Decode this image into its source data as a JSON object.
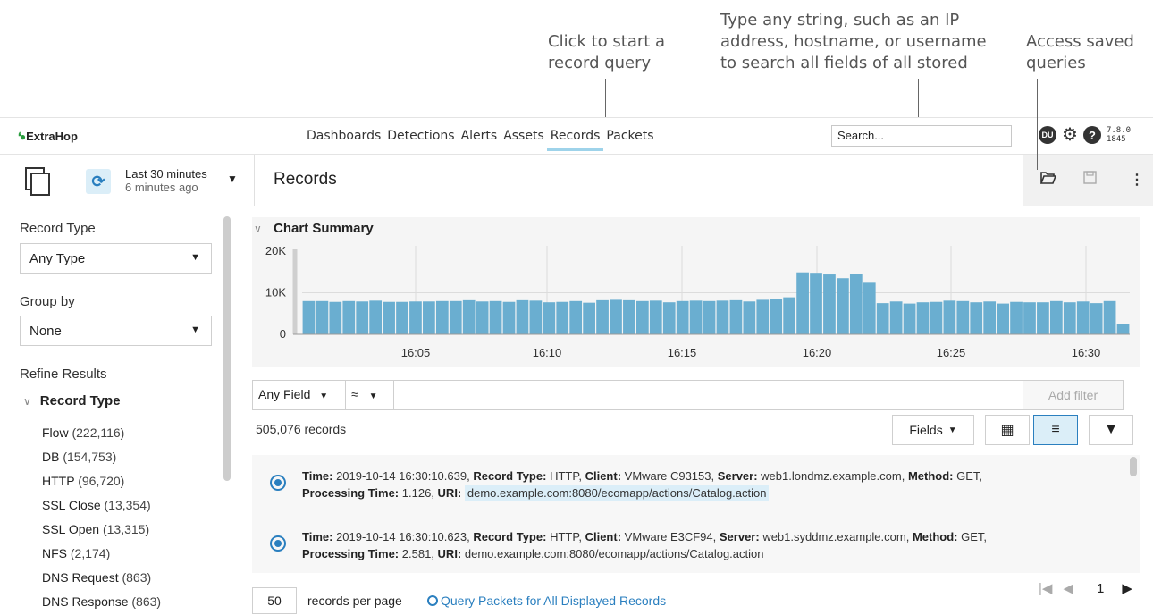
{
  "callouts": {
    "records": [
      "Click to start a",
      "record query"
    ],
    "search": [
      "Type any string, such as an IP",
      "address, hostname, or username",
      "to search all fields of all stored"
    ],
    "saved": [
      "Access saved",
      "queries"
    ]
  },
  "nav": {
    "logo": "ExtraHop",
    "links": [
      "Dashboards",
      "Detections",
      "Alerts",
      "Assets",
      "Records",
      "Packets"
    ],
    "active": "Records",
    "search_value": "Search...",
    "avatar": "DU",
    "version_line1": "7.8.0",
    "version_line2": "1845"
  },
  "toolbar": {
    "time_range": "Last 30 minutes",
    "time_sub": "6 minutes ago",
    "title": "Records"
  },
  "sidebar": {
    "record_type_label": "Record Type",
    "record_type_value": "Any Type",
    "group_by_label": "Group by",
    "group_by_value": "None",
    "refine_label": "Refine Results",
    "refine_group": "Record Type",
    "items": [
      {
        "name": "Flow",
        "count": "(222,116)"
      },
      {
        "name": "DB",
        "count": "(154,753)"
      },
      {
        "name": "HTTP",
        "count": "(96,720)"
      },
      {
        "name": "SSL Close",
        "count": "(13,354)"
      },
      {
        "name": "SSL Open",
        "count": "(13,315)"
      },
      {
        "name": "NFS",
        "count": "(2,174)"
      },
      {
        "name": "DNS Request",
        "count": "(863)"
      },
      {
        "name": "DNS Response",
        "count": "(863)"
      }
    ]
  },
  "chart_summary": {
    "title": "Chart Summary"
  },
  "chart_data": {
    "type": "bar",
    "title": "Chart Summary",
    "ylim": [
      0,
      20000
    ],
    "y_ticks": [
      "20K",
      "10K",
      "0"
    ],
    "x_ticks": [
      "16:05",
      "16:10",
      "16:15",
      "16:20",
      "16:25",
      "16:30"
    ],
    "values": [
      8000,
      8000,
      7800,
      8000,
      7900,
      8100,
      7800,
      7800,
      7900,
      7900,
      8000,
      8000,
      8200,
      7900,
      8000,
      7800,
      8200,
      8100,
      7700,
      7800,
      8000,
      7600,
      8200,
      8300,
      8200,
      8000,
      8100,
      7700,
      8000,
      8100,
      8000,
      8100,
      8200,
      7900,
      8300,
      8600,
      8900,
      14900,
      14800,
      14400,
      13500,
      14600,
      12400,
      7500,
      7900,
      7400,
      7700,
      7800,
      8100,
      8000,
      7700,
      7900,
      7400,
      7800,
      7700,
      7700,
      8000,
      7700,
      7900,
      7500,
      8000,
      2400
    ]
  },
  "filter": {
    "field": "Any Field",
    "operator": "≈",
    "add_label": "Add filter"
  },
  "results": {
    "count_text": "505,076 records",
    "fields_label": "Fields",
    "records": [
      {
        "time_label": "Time:",
        "time": "2019-10-14 16:30:10.639,",
        "type_label": "Record Type:",
        "type": "HTTP,",
        "client_label": "Client:",
        "client": "VMware C93153,",
        "server_label": "Server:",
        "server": "web1.londmz.example.com,",
        "method_label": "Method:",
        "method": "GET,",
        "ptime_label": "Processing Time:",
        "ptime": "1.126,",
        "uri_label": "URI:",
        "uri": "demo.example.com:8080/ecomapp/actions/Catalog.action"
      },
      {
        "time_label": "Time:",
        "time": "2019-10-14 16:30:10.623,",
        "type_label": "Record Type:",
        "type": "HTTP,",
        "client_label": "Client:",
        "client": "VMware E3CF94,",
        "server_label": "Server:",
        "server": "web1.syddmz.example.com,",
        "method_label": "Method:",
        "method": "GET,",
        "ptime_label": "Processing Time:",
        "ptime": "2.581,",
        "uri_label": "URI:",
        "uri": "demo.example.com:8080/ecomapp/actions/Catalog.action"
      }
    ]
  },
  "pagination": {
    "per_page": "50",
    "per_page_label": "records per page",
    "query_packets": "Query Packets for All Displayed Records",
    "page": "1"
  }
}
